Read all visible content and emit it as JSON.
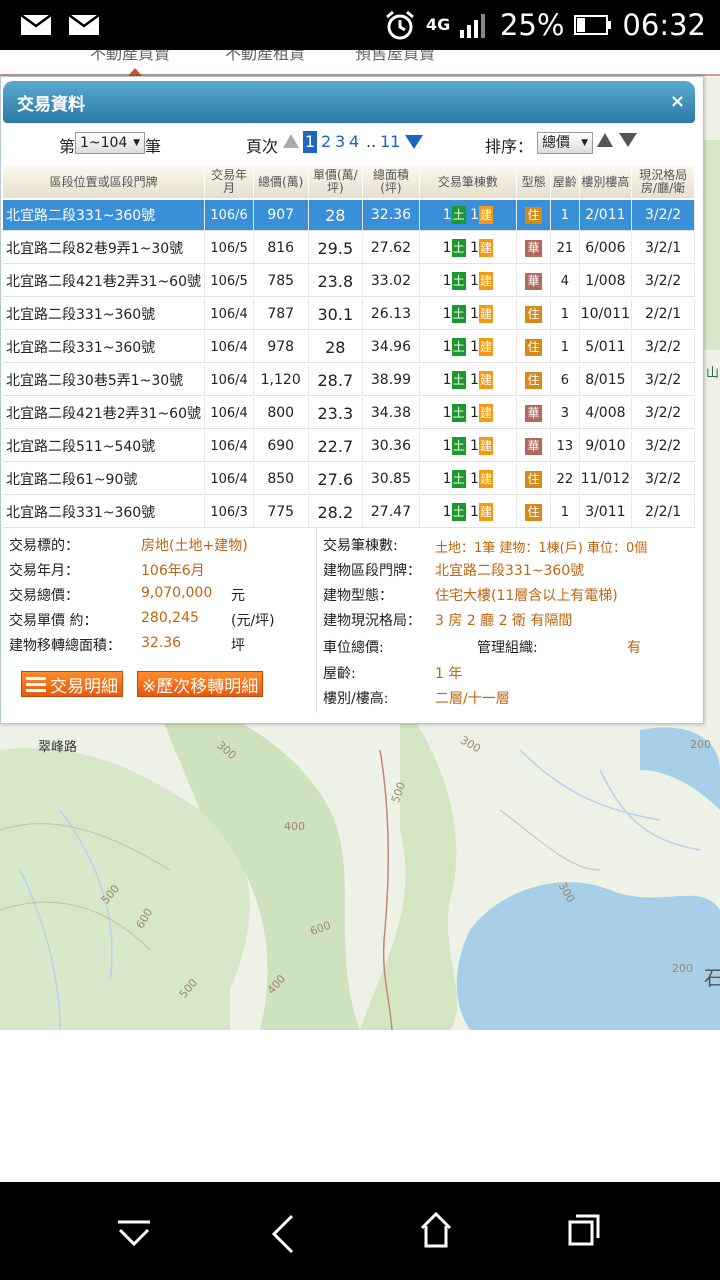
{
  "status_bar": {
    "network": "4G",
    "battery": "25%",
    "time": "06:32"
  },
  "top_tabs": [
    "不動產買賣",
    "不動產租賃",
    "預售屋買賣"
  ],
  "map_labels": {
    "road": "翠峰路",
    "contours": [
      "300",
      "500",
      "400",
      "500",
      "600",
      "600",
      "500",
      "400",
      "200",
      "200",
      "300",
      "300"
    ],
    "edge_glyph": "石",
    "edge_glyph2": "山"
  },
  "panel": {
    "title": "交易資料",
    "close": "×",
    "pager": {
      "prefix": "第",
      "range": "1~104",
      "suffix": "筆",
      "page_label": "頁次",
      "pages": [
        "1",
        "2",
        "3",
        "4",
        "..",
        "11"
      ],
      "current_page": "1",
      "sort_label": "排序：",
      "sort_value": "總價"
    },
    "columns": [
      "區段位置或區段門牌",
      "交易年月",
      "總價(萬)",
      "單價(萬/坪)",
      "總面積(坪)",
      "交易筆棟數",
      "型態",
      "屋齡",
      "樓別樓高",
      "現況格局房/廳/衛"
    ],
    "rows": [
      {
        "loc": "北宜路二段331~360號",
        "ym": "106/6",
        "total": "907",
        "unit": "28",
        "area": "32.36",
        "n1": "1",
        "t1": "土",
        "n2": "1",
        "t2": "建",
        "type": "住",
        "age": "1",
        "floor": "2/011",
        "layout": "3/2/2"
      },
      {
        "loc": "北宜路二段82巷9弄1~30號",
        "ym": "106/5",
        "total": "816",
        "unit": "29.5",
        "area": "27.62",
        "n1": "1",
        "t1": "土",
        "n2": "1",
        "t2": "建",
        "type": "華",
        "age": "21",
        "floor": "6/006",
        "layout": "3/2/1"
      },
      {
        "loc": "北宜路二段421巷2弄31~60號",
        "ym": "106/5",
        "total": "785",
        "unit": "23.8",
        "area": "33.02",
        "n1": "1",
        "t1": "土",
        "n2": "1",
        "t2": "建",
        "type": "華",
        "age": "4",
        "floor": "1/008",
        "layout": "3/2/2"
      },
      {
        "loc": "北宜路二段331~360號",
        "ym": "106/4",
        "total": "787",
        "unit": "30.1",
        "area": "26.13",
        "n1": "1",
        "t1": "土",
        "n2": "1",
        "t2": "建",
        "type": "住",
        "age": "1",
        "floor": "10/011",
        "layout": "2/2/1"
      },
      {
        "loc": "北宜路二段331~360號",
        "ym": "106/4",
        "total": "978",
        "unit": "28",
        "area": "34.96",
        "n1": "1",
        "t1": "土",
        "n2": "1",
        "t2": "建",
        "type": "住",
        "age": "1",
        "floor": "5/011",
        "layout": "3/2/2"
      },
      {
        "loc": "北宜路二段30巷5弄1~30號",
        "ym": "106/4",
        "total": "1,120",
        "unit": "28.7",
        "area": "38.99",
        "n1": "1",
        "t1": "土",
        "n2": "1",
        "t2": "建",
        "type": "住",
        "age": "6",
        "floor": "8/015",
        "layout": "3/2/2"
      },
      {
        "loc": "北宜路二段421巷2弄31~60號",
        "ym": "106/4",
        "total": "800",
        "unit": "23.3",
        "area": "34.38",
        "n1": "1",
        "t1": "土",
        "n2": "1",
        "t2": "建",
        "type": "華",
        "age": "3",
        "floor": "4/008",
        "layout": "3/2/2"
      },
      {
        "loc": "北宜路二段511~540號",
        "ym": "106/4",
        "total": "690",
        "unit": "22.7",
        "area": "30.36",
        "n1": "1",
        "t1": "土",
        "n2": "1",
        "t2": "建",
        "type": "華",
        "age": "13",
        "floor": "9/010",
        "layout": "3/2/2"
      },
      {
        "loc": "北宜路二段61~90號",
        "ym": "106/4",
        "total": "850",
        "unit": "27.6",
        "area": "30.85",
        "n1": "1",
        "t1": "土",
        "n2": "1",
        "t2": "建",
        "type": "住",
        "age": "22",
        "floor": "11/012",
        "layout": "3/2/2"
      },
      {
        "loc": "北宜路二段331~360號",
        "ym": "106/3",
        "total": "775",
        "unit": "28.2",
        "area": "27.47",
        "n1": "1",
        "t1": "土",
        "n2": "1",
        "t2": "建",
        "type": "住",
        "age": "1",
        "floor": "3/011",
        "layout": "2/2/1"
      }
    ],
    "details": {
      "subject_label": "交易標的：",
      "subject": "房地(土地+建物)",
      "ym_label": "交易年月：",
      "ym": "106年6月",
      "total_label": "交易總價：",
      "total": "9,070,000",
      "total_unit": "元",
      "unit_label": "交易單價 約：",
      "unit": "280,245",
      "unit_unit": "(元/坪)",
      "area_label": "建物移轉總面積：",
      "area": "32.36",
      "area_unit": "坪",
      "count_label": "交易筆棟數:",
      "count": "土地：1筆 建物：1棟(戶) 車位：0個",
      "addr_label": "建物區段門牌：",
      "addr": "北宜路二段331~360號",
      "btype_label": "建物型態：",
      "btype": "住宅大樓(11層含以上有電梯)",
      "layout_label": "建物現況格局：",
      "layout": "3 房 2 廳 2 衛 有隔間",
      "parking_label": "車位總價:",
      "mgmt_label": "管理組織:",
      "mgmt": "有",
      "age_label": "屋齡:",
      "age": "1 年",
      "floor_label": "樓別/樓高:",
      "floor": "二層/十一層",
      "btn1": "交易明細",
      "btn2": "※歷次移轉明細"
    }
  }
}
